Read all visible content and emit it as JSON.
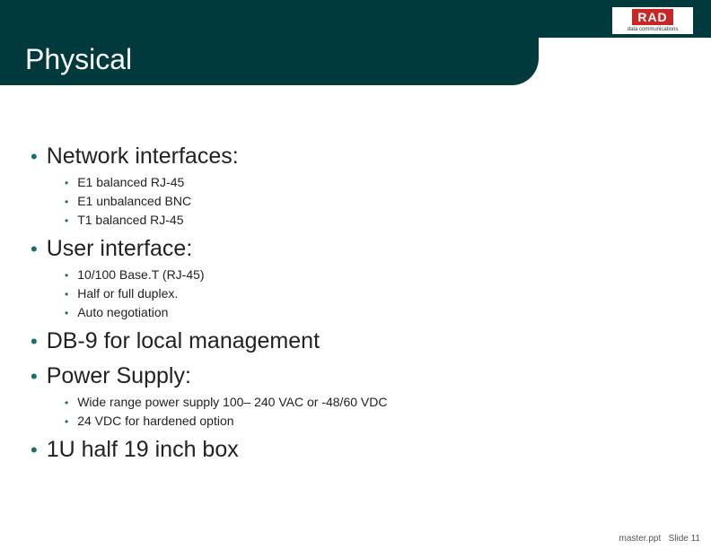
{
  "title": "Physical",
  "logo": {
    "text": "RAD",
    "sub": "data communications"
  },
  "bullets": [
    {
      "text": "Network interfaces:",
      "subs": [
        "E1 balanced RJ-45",
        "E1 unbalanced BNC",
        "T1 balanced RJ-45"
      ]
    },
    {
      "text": "User interface:",
      "subs": [
        "10/100 Base.T (RJ-45)",
        "Half or full duplex.",
        "Auto negotiation"
      ]
    },
    {
      "text": "DB-9 for local management",
      "subs": []
    },
    {
      "text": "Power Supply:",
      "subs": [
        "Wide range power supply 100– 240 VAC or -48/60 VDC",
        "24 VDC for hardened option"
      ]
    },
    {
      "text": "1U half 19 inch box",
      "subs": []
    }
  ],
  "footer": {
    "file": "master.ppt",
    "slide": "Slide 11"
  }
}
